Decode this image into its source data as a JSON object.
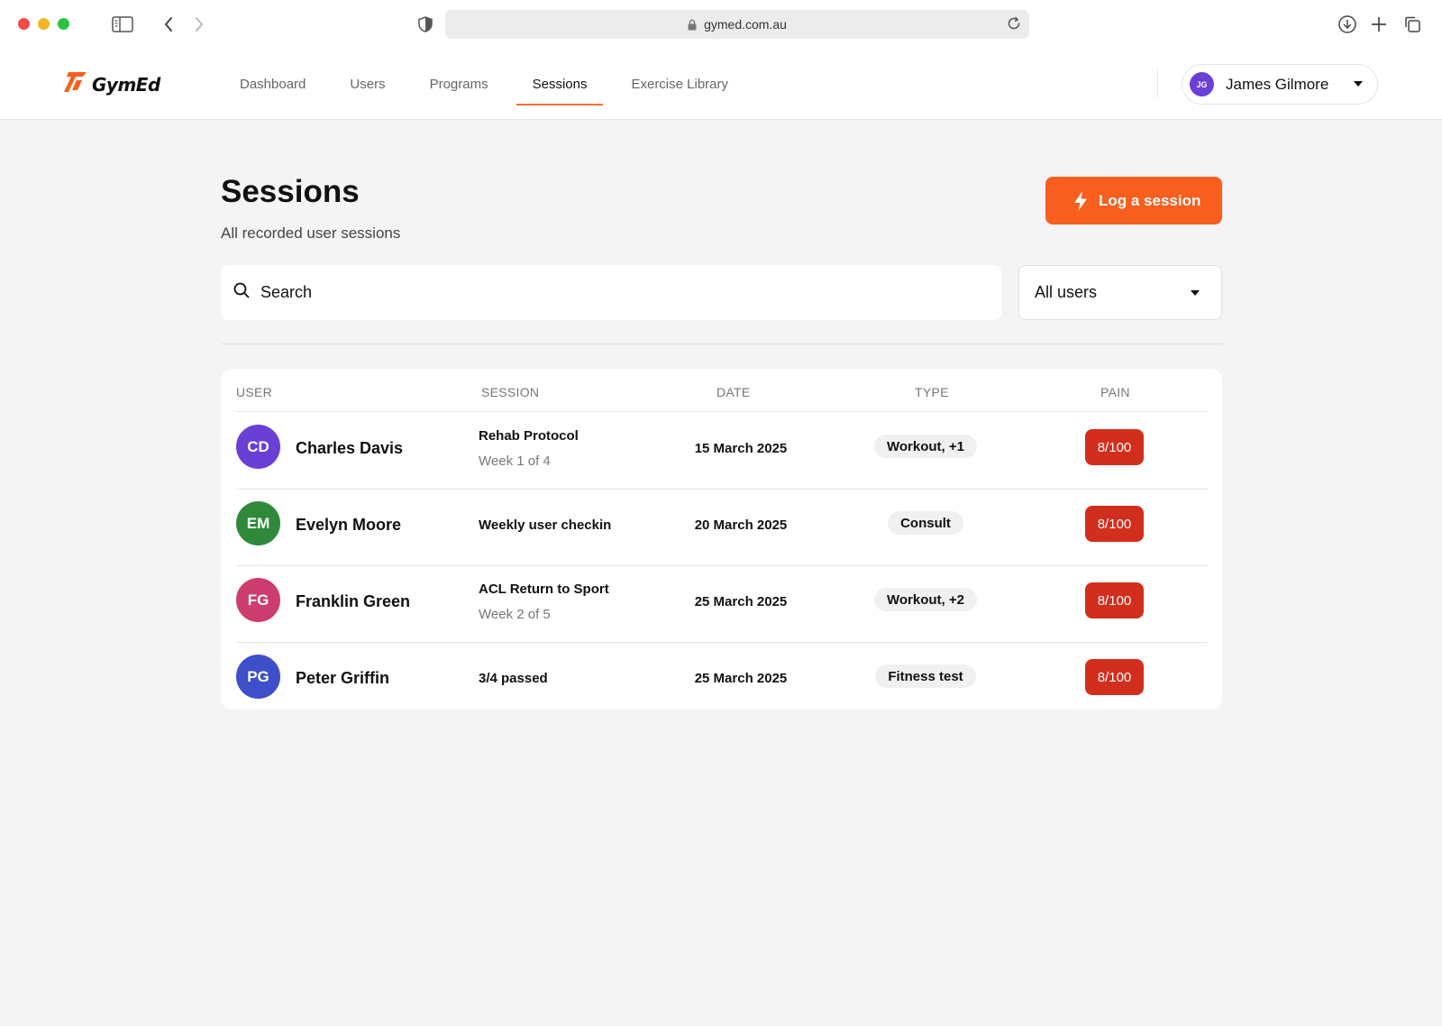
{
  "browser": {
    "url": "gymed.com.au"
  },
  "brand": {
    "name": "GymEd",
    "accent": "#f85e1d"
  },
  "nav": {
    "items": [
      {
        "label": "Dashboard",
        "active": false
      },
      {
        "label": "Users",
        "active": false
      },
      {
        "label": "Programs",
        "active": false
      },
      {
        "label": "Sessions",
        "active": true
      },
      {
        "label": "Exercise Library",
        "active": false
      }
    ]
  },
  "user_menu": {
    "initials": "JG",
    "name": "James Gilmore"
  },
  "page": {
    "title": "Sessions",
    "subtitle": "All recorded user sessions",
    "log_button": "Log a session"
  },
  "search": {
    "placeholder": "Search",
    "value": ""
  },
  "filter": {
    "selected": "All users"
  },
  "table": {
    "headers": {
      "user": "USER",
      "session": "SESSION",
      "date": "DATE",
      "type": "TYPE",
      "pain": "PAIN"
    },
    "rows": [
      {
        "initials": "CD",
        "avatar_color": "#6a3fd6",
        "name": "Charles Davis",
        "session": "Rehab Protocol",
        "session_sub": "Week 1 of 4",
        "date": "15 March 2025",
        "type": "Workout, +1",
        "pain": "8/100"
      },
      {
        "initials": "EM",
        "avatar_color": "#2e8a3a",
        "name": "Evelyn Moore",
        "session": "Weekly user checkin",
        "session_sub": "",
        "date": "20 March 2025",
        "type": "Consult",
        "pain": "8/100"
      },
      {
        "initials": "FG",
        "avatar_color": "#cc3c6e",
        "name": "Franklin Green",
        "session": "ACL Return to Sport",
        "session_sub": "Week 2 of 5",
        "date": "25 March 2025",
        "type": "Workout, +2",
        "pain": "8/100"
      },
      {
        "initials": "PG",
        "avatar_color": "#3d4fc9",
        "name": "Peter Griffin",
        "session": "3/4 passed",
        "session_sub": "",
        "date": "25 March 2025",
        "type": "Fitness test",
        "pain": "8/100"
      }
    ]
  }
}
